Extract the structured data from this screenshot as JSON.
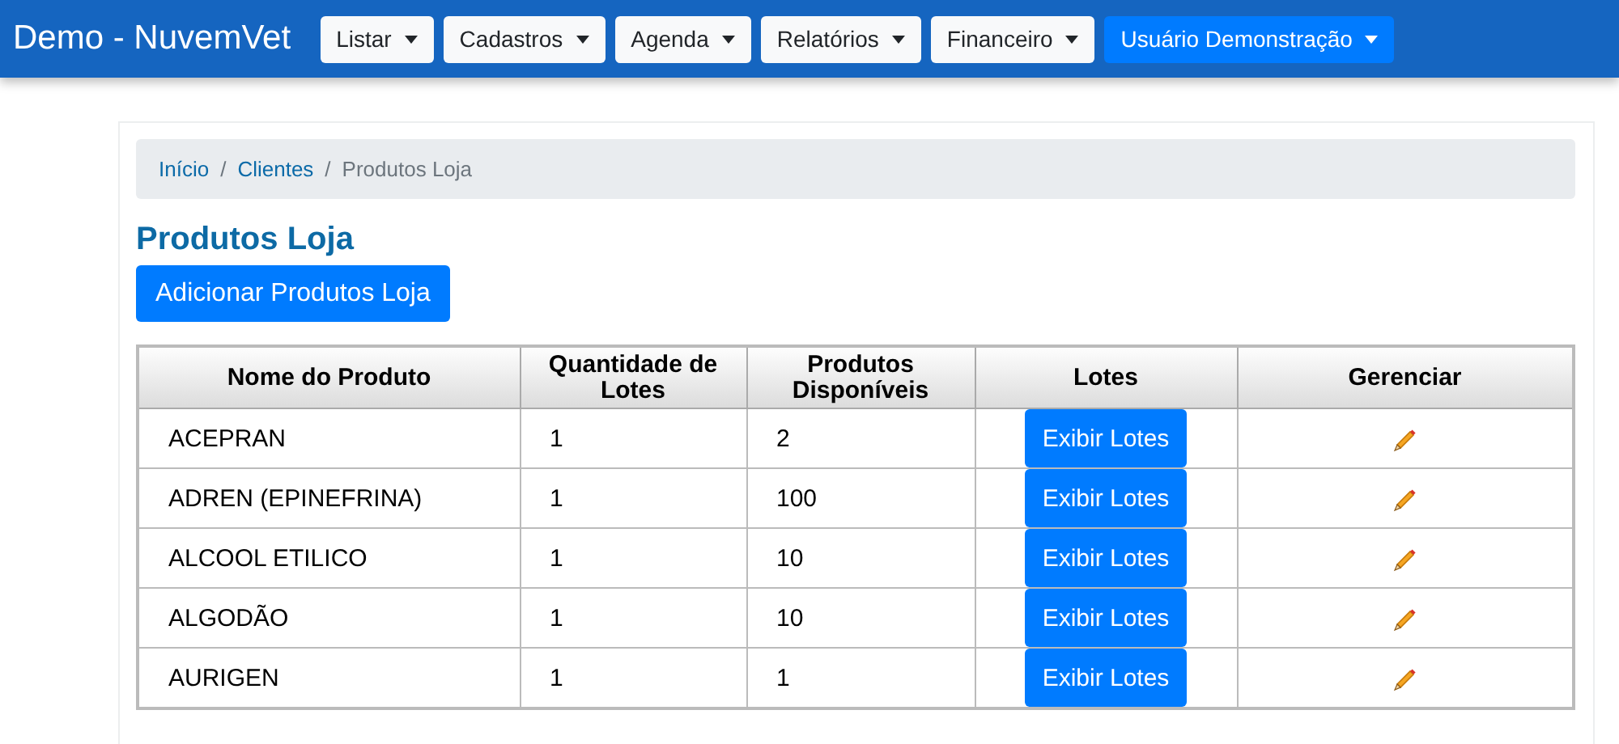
{
  "navbar": {
    "brand": "Demo - NuvemVet",
    "menus": [
      {
        "label": "Listar",
        "kind": "light"
      },
      {
        "label": "Cadastros",
        "kind": "light"
      },
      {
        "label": "Agenda",
        "kind": "light"
      },
      {
        "label": "Relatórios",
        "kind": "light"
      },
      {
        "label": "Financeiro",
        "kind": "light"
      },
      {
        "label": "Usuário Demonstração",
        "kind": "primary"
      }
    ]
  },
  "breadcrumb": [
    {
      "label": "Início",
      "current": false
    },
    {
      "separator": "/",
      "label": "Clientes",
      "current": false
    },
    {
      "separator": "/",
      "label": "Produtos Loja",
      "current": true
    }
  ],
  "page_title": "Produtos Loja",
  "add_button": "Adicionar Produtos Loja",
  "table": {
    "columns": [
      "Nome do Produto",
      "Quantidade de Lotes",
      "Produtos Disponíveis",
      "Lotes",
      "Gerenciar"
    ],
    "rows": [
      {
        "name": "ACEPRAN",
        "lots": "1",
        "available": "2",
        "lots_button": "Exibir Lotes"
      },
      {
        "name": "ADREN (EPINEFRINA)",
        "lots": "1",
        "available": "100",
        "lots_button": "Exibir Lotes"
      },
      {
        "name": "ALCOOL ETILICO",
        "lots": "1",
        "available": "10",
        "lots_button": "Exibir Lotes"
      },
      {
        "name": "ALGODÃO",
        "lots": "1",
        "available": "10",
        "lots_button": "Exibir Lotes"
      },
      {
        "name": "AURIGEN",
        "lots": "1",
        "available": "1",
        "lots_button": "Exibir Lotes"
      }
    ]
  }
}
